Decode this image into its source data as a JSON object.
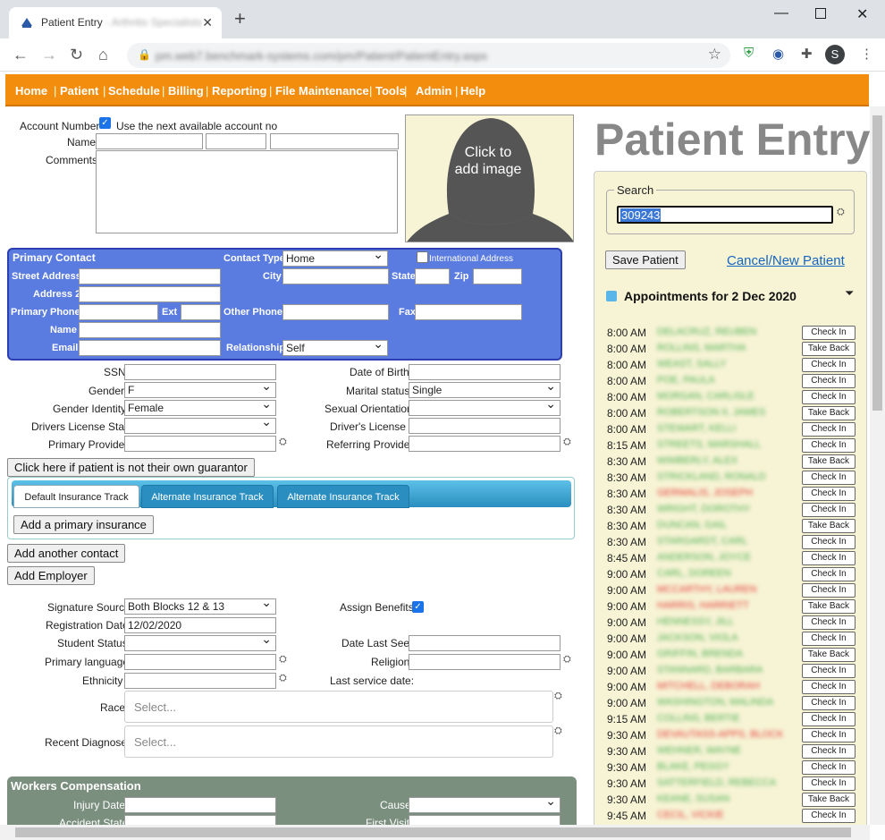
{
  "browser": {
    "tab_title": "Patient Entry",
    "tab_title_suffix": "- Arthritis Specialists",
    "url": "pm.web7.benchmark-systems.com/pm/Patient/PatientEntry.aspx",
    "profile_initial": "S"
  },
  "menu": [
    "Home",
    "Patient",
    "Schedule",
    "Billing",
    "Reporting",
    "File Maintenance",
    "Tools",
    "Admin",
    "Help"
  ],
  "form": {
    "account_number_label": "Account Number",
    "use_next_label": "Use the next available account no",
    "name_label": "Name",
    "comments_label": "Comments",
    "photo_text": "Click to add image",
    "primary_contact": {
      "title": "Primary Contact",
      "contact_type_label": "Contact Type",
      "contact_type_value": "Home",
      "international_label": "International Address",
      "street_label": "Street Address",
      "city_label": "City",
      "state_label": "State",
      "zip_label": "Zip",
      "address2_label": "Address 2",
      "primary_phone_label": "Primary Phone",
      "ext_label": "Ext",
      "other_phone_label": "Other Phone",
      "fax_label": "Fax",
      "name_label": "Name",
      "email_label": "Email",
      "relationship_label": "Relationship",
      "relationship_value": "Self"
    },
    "ssn_label": "SSN",
    "dob_label": "Date of Birth",
    "gender_label": "Gender",
    "gender_value": "F",
    "marital_label": "Marital status",
    "marital_value": "Single",
    "gender_identity_label": "Gender Identity",
    "gender_identity_value": "Female",
    "sexual_orientation_label": "Sexual Orientation",
    "dl_state_label": "Drivers License State",
    "dl_number_label": "Driver's License #",
    "primary_provider_label": "Primary Provider",
    "referring_provider_label": "Referring Provider",
    "guarantor_button": "Click here if patient is not their own guarantor",
    "insurance_tabs": [
      "Default Insurance Track",
      "Alternate Insurance Track",
      "Alternate Insurance Track"
    ],
    "add_primary_insurance": "Add a primary insurance",
    "add_contact": "Add another contact",
    "add_employer": "Add Employer",
    "signature_source_label": "Signature Source",
    "signature_source_value": "Both Blocks 12 & 13",
    "assign_benefits_label": "Assign Benefits",
    "registration_date_label": "Registration Date",
    "registration_date_value": "12/02/2020",
    "student_status_label": "Student Status",
    "date_last_seen_label": "Date Last Seen",
    "primary_language_label": "Primary language",
    "religion_label": "Religion",
    "ethnicity_label": "Ethnicity",
    "last_service_label": "Last service date:",
    "race_label": "Race",
    "race_placeholder": "Select...",
    "recent_diag_label": "Recent Diagnoses",
    "recent_diag_placeholder": "Select...",
    "workers_comp": {
      "title": "Workers Compensation",
      "injury_date_label": "Injury Date",
      "cause_label": "Cause",
      "accident_state_label": "Accident State",
      "first_visit_label": "First Visit"
    }
  },
  "right": {
    "page_title": "Patient Entry",
    "search_legend": "Search",
    "search_value": "309243",
    "save_button": "Save Patient",
    "cancel_link": "Cancel/New Patient",
    "appointments_title": "Appointments for 2 Dec 2020",
    "appointments": [
      {
        "time": "8:00 AM",
        "name": "DELACRUZ, REUBEN",
        "color": "#4caf50",
        "action": "Check In"
      },
      {
        "time": "8:00 AM",
        "name": "ROLLINS, MARTHA",
        "color": "#4caf50",
        "action": "Take Back"
      },
      {
        "time": "8:00 AM",
        "name": "WEAST, SALLY",
        "color": "#4caf50",
        "action": "Check In"
      },
      {
        "time": "8:00 AM",
        "name": "POE, PAULA",
        "color": "#4caf50",
        "action": "Check In"
      },
      {
        "time": "8:00 AM",
        "name": "MORGAN, CARLISLE",
        "color": "#4caf50",
        "action": "Check In"
      },
      {
        "time": "8:00 AM",
        "name": "ROBERTSON II, JAMES",
        "color": "#4caf50",
        "action": "Take Back"
      },
      {
        "time": "8:00 AM",
        "name": "STEWART, KELLI",
        "color": "#4caf50",
        "action": "Check In"
      },
      {
        "time": "8:15 AM",
        "name": "STREETS, MARSHALL",
        "color": "#4caf50",
        "action": "Check In"
      },
      {
        "time": "8:30 AM",
        "name": "WIMBERLY, ALEX",
        "color": "#4caf50",
        "action": "Take Back"
      },
      {
        "time": "8:30 AM",
        "name": "STRICKLAND, RONALD",
        "color": "#4caf50",
        "action": "Check In"
      },
      {
        "time": "8:30 AM",
        "name": "GERMALIS, JOSEPH",
        "color": "#e53935",
        "action": "Check In"
      },
      {
        "time": "8:30 AM",
        "name": "WRIGHT, DOROTHY",
        "color": "#4caf50",
        "action": "Check In"
      },
      {
        "time": "8:30 AM",
        "name": "DUNCAN, GAIL",
        "color": "#4caf50",
        "action": "Take Back"
      },
      {
        "time": "8:30 AM",
        "name": "STARGARDT, CARL",
        "color": "#4caf50",
        "action": "Check In"
      },
      {
        "time": "8:45 AM",
        "name": "ANDERSON, JOYCE",
        "color": "#4caf50",
        "action": "Check In"
      },
      {
        "time": "9:00 AM",
        "name": "CARL, DOREEN",
        "color": "#4caf50",
        "action": "Check In"
      },
      {
        "time": "9:00 AM",
        "name": "MCCARTHY, LAUREN",
        "color": "#e53935",
        "action": "Check In"
      },
      {
        "time": "9:00 AM",
        "name": "HARRIS, HARRIETT",
        "color": "#e53935",
        "action": "Take Back"
      },
      {
        "time": "9:00 AM",
        "name": "HENNESSY, JILL",
        "color": "#4caf50",
        "action": "Check In"
      },
      {
        "time": "9:00 AM",
        "name": "JACKSON, VIOLA",
        "color": "#4caf50",
        "action": "Check In"
      },
      {
        "time": "9:00 AM",
        "name": "GRIFFIN, BRENDA",
        "color": "#4caf50",
        "action": "Take Back"
      },
      {
        "time": "9:00 AM",
        "name": "STANNARD, BARBARA",
        "color": "#4caf50",
        "action": "Check In"
      },
      {
        "time": "9:00 AM",
        "name": "MITCHELL, DEBORAH",
        "color": "#e53935",
        "action": "Check In"
      },
      {
        "time": "9:00 AM",
        "name": "WASHINGTON, MALINDA",
        "color": "#4caf50",
        "action": "Check In"
      },
      {
        "time": "9:15 AM",
        "name": "COLLINS, BERTIE",
        "color": "#4caf50",
        "action": "Check In"
      },
      {
        "time": "9:30 AM",
        "name": "DEVAUTASS-APPS, BLOCK",
        "color": "#e53935",
        "action": "Check In"
      },
      {
        "time": "9:30 AM",
        "name": "WEHNER, WAYNE",
        "color": "#4caf50",
        "action": "Check In"
      },
      {
        "time": "9:30 AM",
        "name": "BLAKE, PEGGY",
        "color": "#4caf50",
        "action": "Check In"
      },
      {
        "time": "9:30 AM",
        "name": "SATTERFIELD, REBECCA",
        "color": "#4caf50",
        "action": "Check In"
      },
      {
        "time": "9:30 AM",
        "name": "KEANE, SUSAN",
        "color": "#4caf50",
        "action": "Take Back"
      },
      {
        "time": "9:45 AM",
        "name": "CECIL, VICKIE",
        "color": "#e53935",
        "action": "Check In"
      }
    ]
  }
}
